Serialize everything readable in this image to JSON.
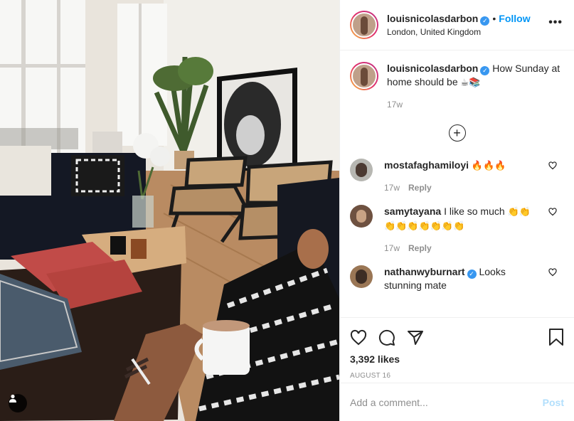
{
  "header": {
    "username": "louisnicolasdarbon",
    "verified_icon": "verified-badge-icon",
    "separator": "•",
    "follow_label": "Follow",
    "location": "London, United Kingdom",
    "more_label": "•••"
  },
  "caption": {
    "username": "louisnicolasdarbon",
    "text": "How Sunday at home should be",
    "emoji": "☕📚",
    "time": "17w"
  },
  "load_more_icon": "plus-circle-icon",
  "comments": [
    {
      "username": "mostafaghamiloyi",
      "verified": false,
      "text": "",
      "emoji": "🔥🔥🔥",
      "time": "17w",
      "reply_label": "Reply"
    },
    {
      "username": "samytayana",
      "verified": false,
      "text": "I like so much",
      "emoji": "👏👏👏👏👏👏👏👏👏",
      "time": "17w",
      "reply_label": "Reply"
    },
    {
      "username": "nathanwyburnart",
      "verified": true,
      "text": "Looks stunning mate",
      "emoji": "",
      "time": "",
      "reply_label": ""
    }
  ],
  "actions": {
    "like_icon": "heart-icon",
    "comment_icon": "comment-icon",
    "share_icon": "share-icon",
    "save_icon": "bookmark-icon"
  },
  "likes": "3,392 likes",
  "date": "AUGUST 16",
  "add_comment": {
    "placeholder": "Add a comment...",
    "post_label": "Post"
  },
  "colors": {
    "link": "#0095f6",
    "verified": "#3897f0",
    "muted": "#8e8e8e",
    "post_disabled": "#b2dffc"
  }
}
